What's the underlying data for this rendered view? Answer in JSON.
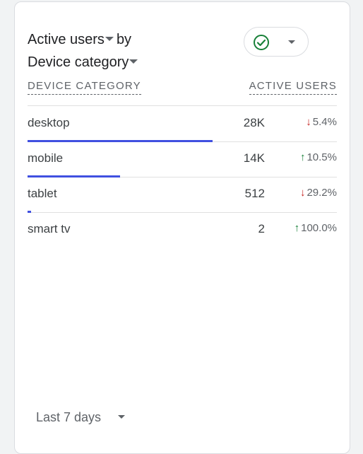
{
  "card": {
    "title_metric": "Active users",
    "title_by": "by",
    "title_dimension": "Device category",
    "status_icon": "check-circle-icon",
    "status_color": "#188038"
  },
  "table": {
    "col_dimension": "DEVICE CATEGORY",
    "col_metric": "ACTIVE USERS",
    "rows": [
      {
        "name": "desktop",
        "value": "28K",
        "change": "5.4%",
        "direction": "down",
        "share": 1.0
      },
      {
        "name": "mobile",
        "value": "14K",
        "change": "10.5%",
        "direction": "up",
        "share": 0.5
      },
      {
        "name": "tablet",
        "value": "512",
        "change": "29.2%",
        "direction": "down",
        "share": 0.018
      },
      {
        "name": "smart tv",
        "value": "2",
        "change": "100.0%",
        "direction": "up",
        "share": 0.0001
      }
    ]
  },
  "footer": {
    "date_range": "Last 7 days"
  },
  "colors": {
    "bar": "#4050e0",
    "up": "#188038",
    "down": "#c5221f"
  }
}
